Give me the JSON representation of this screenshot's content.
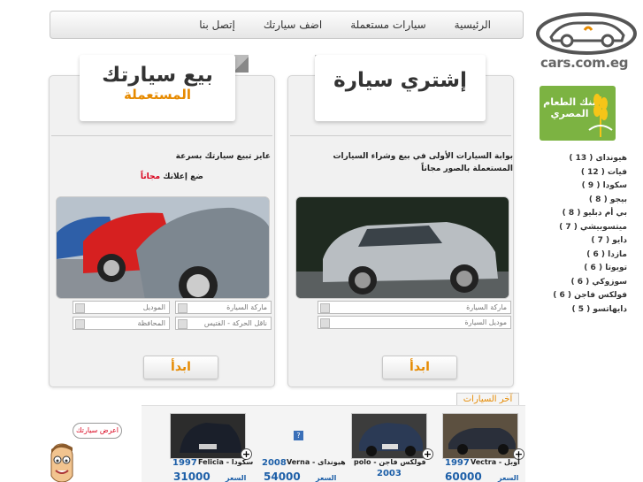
{
  "nav": {
    "items": [
      {
        "label": "الرئيسية"
      },
      {
        "label": "سيارات مستعملة"
      },
      {
        "label": "اضف سيارتك"
      },
      {
        "label": "إتصل بنا"
      }
    ]
  },
  "logo": {
    "text": "cars.com.eg"
  },
  "badge": {
    "text": "بنك الطعام المصري"
  },
  "brands": [
    "هيونداى ( 13 )",
    "فيات ( 12 )",
    "سكودا ( 9 )",
    "بيجو ( 8 )",
    "بي أم دبليو ( 8 )",
    "ميتسوبيشي ( 7 )",
    "دايو ( 7 )",
    "مازدا ( 6 )",
    "تويوتا ( 6 )",
    "سوزوكي ( 6 )",
    "فولكس فاجن ( 6 )",
    "دايهاتسو ( 5 )"
  ],
  "buy": {
    "title": "إشتري سيارة",
    "description": "بوابة السيارات الأولى في بيع وشراء السيارات المستعملة بالصور مجاناً",
    "select_brand": "ماركة السيارة",
    "select_model": "موديل السيارة",
    "button": "ابدأ"
  },
  "sell": {
    "title": "بيع سيارتك",
    "subtitle": "المستعملة",
    "line1": "عايز تبيع سيارتك بسرعة",
    "line2_prefix": "ضع إعلانك ",
    "line2_free": "مجاناً",
    "select_brand": "ماركة السيارة",
    "select_model": "الموديل",
    "select_gear": "ناقل الحركة - الفتيس",
    "select_gov": "المحافظة",
    "button": "ابدأ"
  },
  "latest": {
    "title": "آخر السيارات",
    "price_label": "السعر",
    "cars": [
      {
        "name": "Vectra - أوبل",
        "year": "1997",
        "price": "60000"
      },
      {
        "name": "polo - فولكس فاجن",
        "year": "2003",
        "price": ""
      },
      {
        "name": "Verna - هيونداى",
        "year": "2008",
        "price": "54000"
      },
      {
        "name": "Felicia - سكودا",
        "year": "1997",
        "price": "31000"
      }
    ]
  },
  "mascot": {
    "bubble": "اعرض سيارتك"
  },
  "colors": {
    "accent": "#e68a00",
    "link": "#1d5fa8",
    "free": "#d9001b",
    "badge": "#7cb342"
  }
}
